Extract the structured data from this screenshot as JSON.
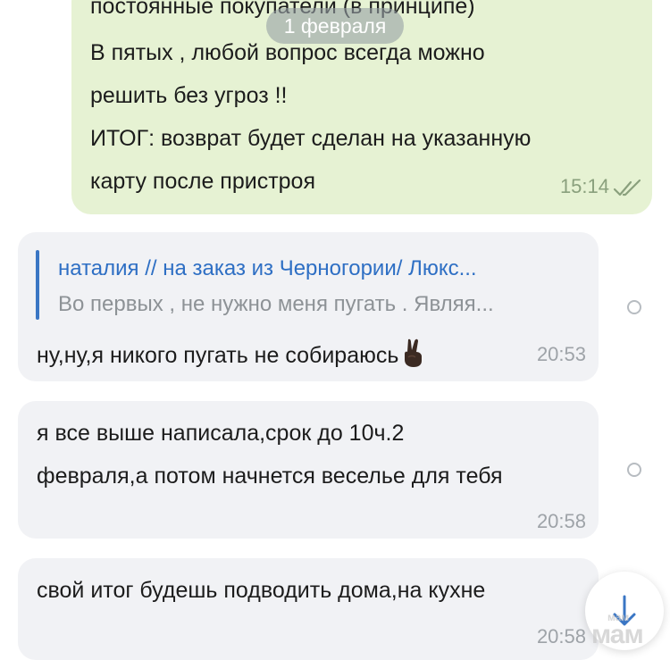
{
  "date_pill": "1 февраля",
  "outgoing": {
    "lines": [
      "постоянные покупатели (в принципе)",
      "В пятых , любой вопрос всегда можно",
      "решить без угроз !!",
      "ИТОГ: возврат будет сделан на указанную",
      "карту после пристроя"
    ],
    "time": "15:14",
    "status_icon": "double-check-icon"
  },
  "messages": [
    {
      "reply": {
        "author": "наталия // на заказ из Черногории/ Люкс...",
        "preview": "Во первых , не нужно меня пугать . Являя..."
      },
      "text": "ну,ну,я никого пугать не собираюсь",
      "emoji": "victory-hand-icon",
      "time": "20:53"
    },
    {
      "lines": [
        "я все выше написала,срок до 10ч.2",
        "февраля,а потом начнется веселье для тебя"
      ],
      "time": "20:58"
    },
    {
      "text": "свой итог будешь подводить дома,на кухне",
      "time": "20:58"
    }
  ],
  "watermark": "мам",
  "watermark_small": "мам",
  "colors": {
    "outgoing_bg": "#e6f2d3",
    "incoming_bg": "#f1f2f5",
    "link_blue": "#2e6fc4"
  }
}
